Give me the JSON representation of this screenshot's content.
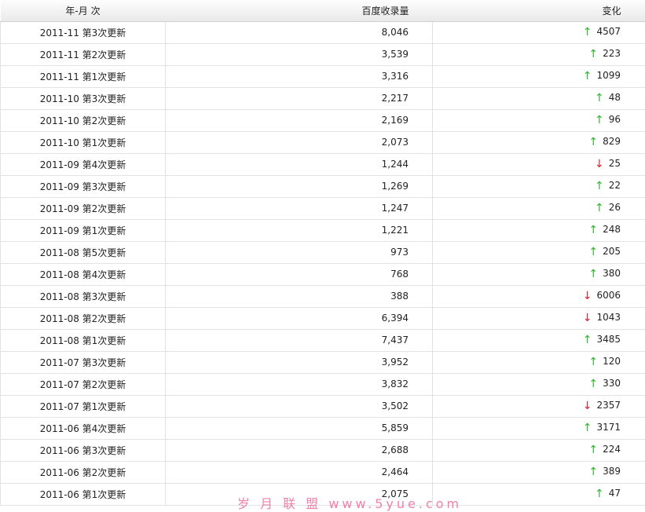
{
  "table": {
    "headers": {
      "date": "年-月 次",
      "count": "百度收录量",
      "change": "变化"
    },
    "rows": [
      {
        "date": "2011-11 第3次更新",
        "count": "8,046",
        "direction": "up",
        "change": "4507"
      },
      {
        "date": "2011-11 第2次更新",
        "count": "3,539",
        "direction": "up",
        "change": "223"
      },
      {
        "date": "2011-11 第1次更新",
        "count": "3,316",
        "direction": "up",
        "change": "1099"
      },
      {
        "date": "2011-10 第3次更新",
        "count": "2,217",
        "direction": "up",
        "change": "48"
      },
      {
        "date": "2011-10 第2次更新",
        "count": "2,169",
        "direction": "up",
        "change": "96"
      },
      {
        "date": "2011-10 第1次更新",
        "count": "2,073",
        "direction": "up",
        "change": "829"
      },
      {
        "date": "2011-09 第4次更新",
        "count": "1,244",
        "direction": "down",
        "change": "25"
      },
      {
        "date": "2011-09 第3次更新",
        "count": "1,269",
        "direction": "up",
        "change": "22"
      },
      {
        "date": "2011-09 第2次更新",
        "count": "1,247",
        "direction": "up",
        "change": "26"
      },
      {
        "date": "2011-09 第1次更新",
        "count": "1,221",
        "direction": "up",
        "change": "248"
      },
      {
        "date": "2011-08 第5次更新",
        "count": "973",
        "direction": "up",
        "change": "205"
      },
      {
        "date": "2011-08 第4次更新",
        "count": "768",
        "direction": "up",
        "change": "380"
      },
      {
        "date": "2011-08 第3次更新",
        "count": "388",
        "direction": "down",
        "change": "6006"
      },
      {
        "date": "2011-08 第2次更新",
        "count": "6,394",
        "direction": "down",
        "change": "1043"
      },
      {
        "date": "2011-08 第1次更新",
        "count": "7,437",
        "direction": "up",
        "change": "3485"
      },
      {
        "date": "2011-07 第3次更新",
        "count": "3,952",
        "direction": "up",
        "change": "120"
      },
      {
        "date": "2011-07 第2次更新",
        "count": "3,832",
        "direction": "up",
        "change": "330"
      },
      {
        "date": "2011-07 第1次更新",
        "count": "3,502",
        "direction": "down",
        "change": "2357"
      },
      {
        "date": "2011-06 第4次更新",
        "count": "5,859",
        "direction": "up",
        "change": "3171"
      },
      {
        "date": "2011-06 第3次更新",
        "count": "2,688",
        "direction": "up",
        "change": "224"
      },
      {
        "date": "2011-06 第2次更新",
        "count": "2,464",
        "direction": "up",
        "change": "389"
      },
      {
        "date": "2011-06 第1次更新",
        "count": "2,075",
        "direction": "up",
        "change": "47"
      }
    ]
  },
  "arrows": {
    "up": "↑",
    "down": "↓",
    "up_icon": "arrow-up-icon",
    "down_icon": "arrow-down-icon",
    "up_color": "#2db52d",
    "down_color": "#d8232a"
  },
  "watermark": "岁 月 联 盟  www.5yue.com"
}
